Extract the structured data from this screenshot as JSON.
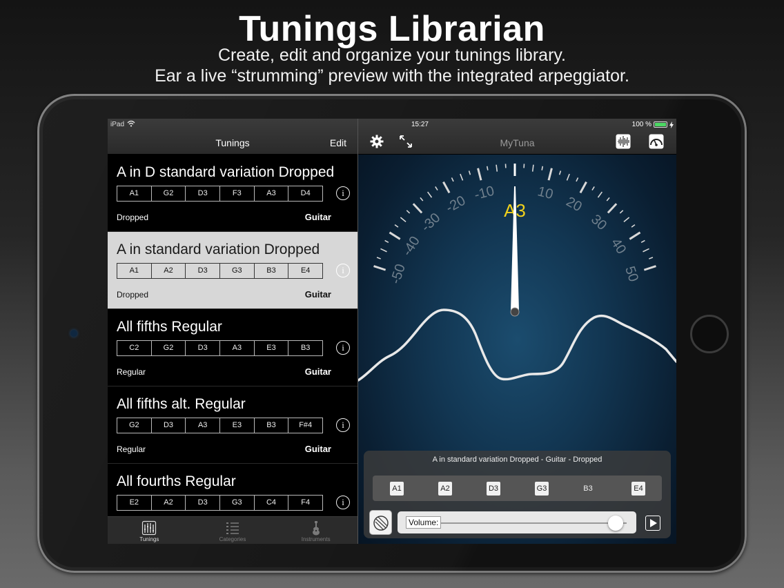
{
  "promo": {
    "title": "Tunings Librarian",
    "line1": "Create, edit and organize your tunings library.",
    "line2": "Ear a live “strumming” preview with the integrated arpeggiator."
  },
  "status": {
    "device": "iPad",
    "time": "15:27",
    "battery": "100 %"
  },
  "left_nav": {
    "title": "Tunings",
    "edit_label": "Edit"
  },
  "tunings": [
    {
      "name": "A in D standard variation Dropped",
      "notes": [
        "A1",
        "G2",
        "D3",
        "F3",
        "A3",
        "D4"
      ],
      "category": "Dropped",
      "instrument": "Guitar"
    },
    {
      "name": "A in standard variation Dropped",
      "notes": [
        "A1",
        "A2",
        "D3",
        "G3",
        "B3",
        "E4"
      ],
      "category": "Dropped",
      "instrument": "Guitar"
    },
    {
      "name": "All fifths Regular",
      "notes": [
        "C2",
        "G2",
        "D3",
        "A3",
        "E3",
        "B3"
      ],
      "category": "Regular",
      "instrument": "Guitar"
    },
    {
      "name": "All fifths alt. Regular",
      "notes": [
        "G2",
        "D3",
        "A3",
        "E3",
        "B3",
        "F#4"
      ],
      "category": "Regular",
      "instrument": "Guitar"
    },
    {
      "name": "All fourths Regular",
      "notes": [
        "E2",
        "A2",
        "D3",
        "G3",
        "C4",
        "F4"
      ],
      "category": "",
      "instrument": ""
    }
  ],
  "selected_index": 1,
  "tabs": [
    {
      "label": "Tunings",
      "icon": "tuning-forks-icon",
      "active": true
    },
    {
      "label": "Categories",
      "icon": "list-icon",
      "active": false
    },
    {
      "label": "Instruments",
      "icon": "guitar-icon",
      "active": false
    }
  ],
  "right_nav": {
    "app_title": "MyTuna",
    "icons": [
      "gear-icon",
      "expand-icon",
      "waveform-icon",
      "speedometer-icon"
    ]
  },
  "tuner": {
    "detected_note": "A3",
    "cents_offset": 0,
    "scale_labels": [
      "-50",
      "-40",
      "-30",
      "-20",
      "-10",
      "10",
      "20",
      "30",
      "40",
      "50"
    ],
    "colors": {
      "note": "#f2d21c",
      "needle": "#ffffff",
      "ticks": "#d8d8d8"
    }
  },
  "preview": {
    "title": "A in standard variation Dropped - Guitar - Dropped",
    "strings": [
      "A1",
      "A2",
      "D3",
      "G3",
      "B3",
      "E4"
    ],
    "current_string_index": 4,
    "volume_label": "Volume:",
    "volume": 0.94
  },
  "colors": {
    "accent_active_tab": "#dddddd",
    "battery": "#4cd964",
    "selected_row": "#d7d7d7"
  }
}
